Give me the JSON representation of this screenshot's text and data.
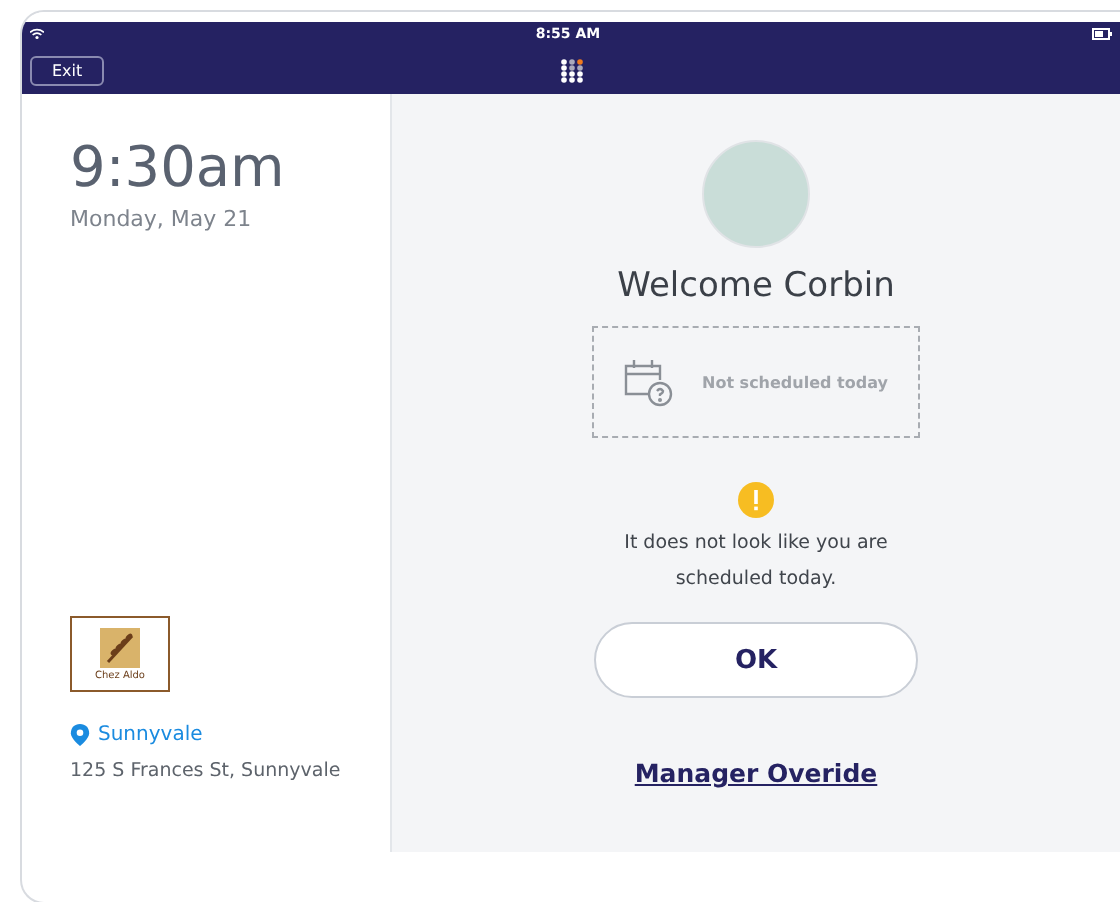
{
  "status_bar": {
    "time": "8:55 AM"
  },
  "nav_bar": {
    "exit_button": "Exit"
  },
  "sidebar": {
    "time": "9:30am",
    "date": "Monday, May 21",
    "logo_text": "Chez Aldo",
    "location": "Sunnyvale",
    "address": "125 S Frances St, Sunnyvale"
  },
  "main": {
    "greeting": "Welcome Corbin",
    "schedule_status": "Not scheduled today",
    "message": "It does not look like you are scheduled today.",
    "ok_button": "OK",
    "manager_link": "Manager Overide"
  }
}
